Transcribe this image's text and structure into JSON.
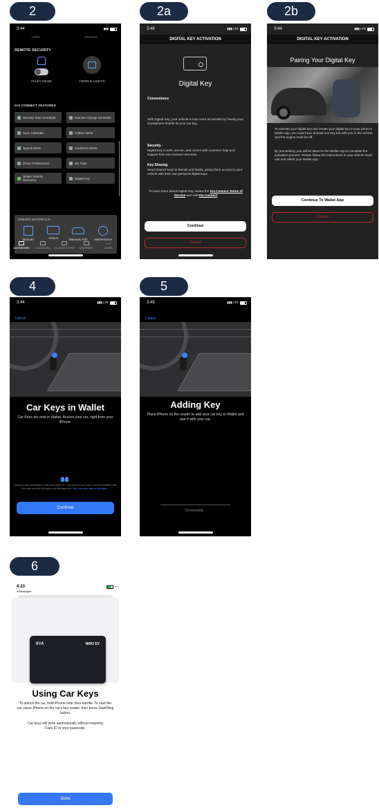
{
  "labels": {
    "s2": "2",
    "s2a": "2a",
    "s2b": "2b",
    "s4": "4",
    "s5": "5",
    "s6": "6"
  },
  "colors": {
    "pill": "#1d2a44",
    "accent_blue": "#3478f6",
    "cancel_red": "#c03030"
  },
  "screen2": {
    "time": "3:44",
    "top_left": "LOCK",
    "top_right": "UNLOCK",
    "remote_security": "REMOTE SECURITY",
    "valet_mode": "VALET MODE",
    "horn_lights": "HORN & LIGHTS",
    "features_title": "KIA CONNECT FEATURES",
    "features": [
      "Remote Start Schedule",
      "Remote Charge Schedule",
      "Sync Calendar",
      "Coffee Alerts",
      "Speed Alerts",
      "Geofence Alerts",
      "Driver Preferences",
      "My Trips",
      "Stolen Vehicle Recovery",
      "Digital Key"
    ],
    "owner_title": "OWNER MATERIALS",
    "owner_items": [
      "Manuals",
      "Videos",
      "Warranty Info",
      "Maintenance"
    ],
    "tabs": [
      "DASHBOARD",
      "LOCATIONS",
      "ACCOUNT INFO",
      "ASSISTANT",
      "MORE"
    ]
  },
  "screen2a": {
    "time": "3:48",
    "title": "DIGITAL KEY ACTIVATION",
    "heading": "Digital Key",
    "convenience_h": "Convenience",
    "convenience_p": "With Digital Key, your vehicle is now more accessible by having your smartphone double as your car key.",
    "security_h": "Security",
    "security_p": "Digital Key is safe, secure, and comes with customer help and support from Kia Connect Services.",
    "sharing_h": "Key Sharing",
    "sharing_p": "Send Shared Keys to friends and family, giving them access to your vehicle with their own personal digital keys.",
    "learn_prefix": "To learn more about Digital Key, review the",
    "learn_link1": "Kia Connect Terms of Service",
    "learn_mid": "and visit",
    "learn_link2": "Kia Connect",
    "continue": "Continue",
    "cancel": "Cancel"
  },
  "screen2b": {
    "time": "3:44",
    "title": "DIGITAL KEY ACTIVATION",
    "heading": "Pairing Your Digital Key",
    "p1": "To activate your digital key and create your digital key in your phone's Wallet App, you must have at least one key fob with you in the vehicle and the engine must be off.",
    "p2": "By proceeding, you will be taken to the Wallet App to complete the activation process. Please follow the instructions in your vehicle head unit and within your Wallet App.",
    "continue": "Continue To Wallet App",
    "cancel": "Cancel"
  },
  "screen4": {
    "time": "3:44",
    "cancel": "Cancel",
    "title": "Car Keys in Wallet",
    "subtitle": "Car Keys are now in Wallet. Access your car, right from your iPhone.",
    "privacy": "Adding a pass associates it with your Apple ID. Your device may share a device identifier with the pass provider for setup and management.",
    "privacy_link": "See how your data is managed...",
    "continue": "Continue"
  },
  "screen5": {
    "time": "3:45",
    "cancel": "Cancel",
    "title": "Adding Key",
    "subtitle": "Place iPhone on the reader to add your car key to Wallet and pair it with your car.",
    "connecting": "Connecting..."
  },
  "screen6": {
    "time": "4:23",
    "back": "◂ Messages",
    "card_logo": "KIA",
    "card_model": "NIRO EV",
    "title": "Using Car Keys",
    "p1": "To unlock the car, hold iPhone near door handle. To start the car, place iPhone on the car's key reader, then press Start/Stop button.",
    "p2": "Car keys will work automatically without requiring Face ID or your passcode.",
    "done": "Done"
  }
}
